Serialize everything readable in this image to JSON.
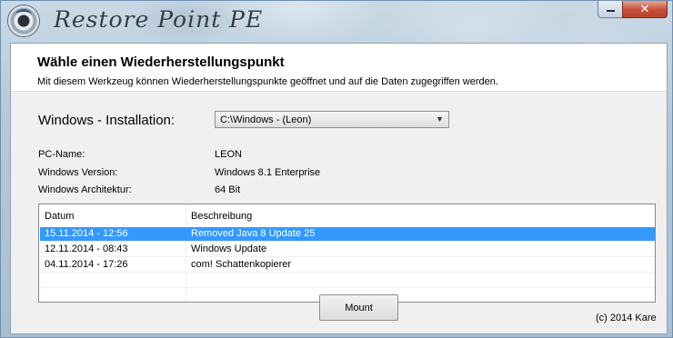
{
  "window": {
    "title": "Restore Point PE",
    "close_glyph": "✕",
    "icons": {
      "logo": "disc-logo-icon",
      "minimize": "minimize-icon",
      "close": "close-icon"
    }
  },
  "header": {
    "heading": "Wähle einen Wiederherstellungspunkt",
    "description": "Mit diesem Werkzeug können Wiederherstellungspunkte geöffnet und auf die Daten zugegriffen werden."
  },
  "form": {
    "installation_label": "Windows - Installation:",
    "installation_value": "C:\\Windows - (Leon)",
    "info": [
      {
        "label": "PC-Name:",
        "value": "LEON"
      },
      {
        "label": "Windows Version:",
        "value": "Windows 8.1 Enterprise"
      },
      {
        "label": "Windows Architektur:",
        "value": "64 Bit"
      }
    ]
  },
  "restore_points": {
    "columns": [
      "Datum",
      "Beschreibung"
    ],
    "rows": [
      {
        "date": "15.11.2014 - 12:56",
        "description": "Removed Java 8 Update 25",
        "selected": true
      },
      {
        "date": "12.11.2014 - 08:43",
        "description": "Windows Update",
        "selected": false
      },
      {
        "date": "04.11.2014 - 17:26",
        "description": "com! Schattenkopierer",
        "selected": false
      }
    ]
  },
  "actions": {
    "mount_label": "Mount"
  },
  "footer": {
    "copyright": "(c) 2014 Kare"
  },
  "colors": {
    "selection": "#3399ff",
    "close_button": "#c7503a",
    "title_bar": "#b6c9d8"
  }
}
